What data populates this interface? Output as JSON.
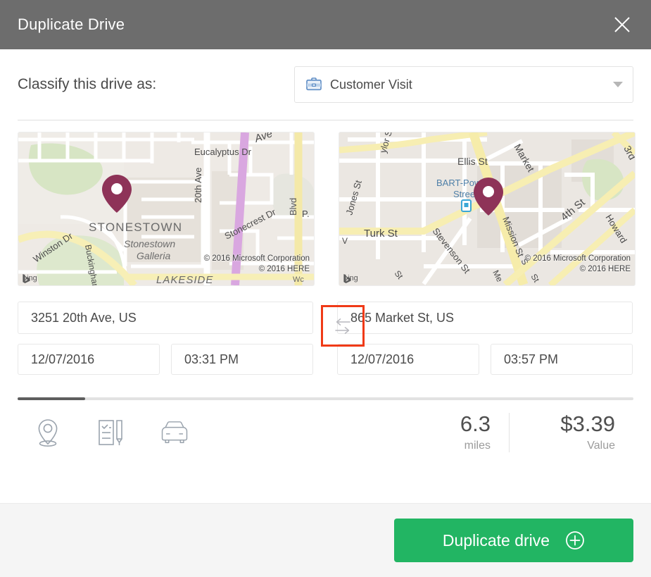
{
  "window": {
    "title": "Duplicate Drive",
    "close_icon": "close-icon"
  },
  "classify": {
    "label": "Classify this drive as:",
    "selected": "Customer Visit",
    "icon": "briefcase-icon",
    "caret_icon": "chevron-down-icon"
  },
  "maps": {
    "start": {
      "provider": "bing",
      "copyright_line1": "© 2016 Microsoft Corporation",
      "copyright_line2": "© 2016 HERE",
      "labels": [
        "Eucalyptus Dr",
        "20th Ave",
        "STONESTOWN",
        "Stonestown",
        "Galleria",
        "Winston Dr",
        "Buckingham",
        "Stonecrest Dr",
        "LAKESIDE",
        "Ave",
        "P",
        "Blvd"
      ]
    },
    "end": {
      "provider": "bing",
      "copyright_line1": "© 2016 Microsoft Corporation",
      "copyright_line2": "© 2016 HERE",
      "labels": [
        "Ellis St",
        "Market",
        "3rd",
        "Jones St",
        "ylor St",
        "BART-Powell",
        "Street",
        "Turk St",
        "Stevenson St",
        "Mission St",
        "4th St",
        "Howard",
        "St",
        "Me"
      ]
    }
  },
  "trip": {
    "start_address": "3251 20th Ave, US",
    "end_address": "865 Market St, US",
    "start_date": "12/07/2016",
    "start_time": "03:31 PM",
    "end_date": "12/07/2016",
    "end_time": "03:57 PM",
    "swap_icon": "swap-arrows-icon"
  },
  "progress": {
    "percent": 11
  },
  "stats": {
    "icons": [
      "location-pin-icon",
      "notes-icon",
      "car-icon"
    ],
    "values": [
      {
        "number": "6.3",
        "caption": "miles"
      },
      {
        "number": "$3.39",
        "caption": "Value"
      }
    ]
  },
  "footer": {
    "primary_label": "Duplicate drive",
    "primary_icon": "plus-circle-icon"
  },
  "colors": {
    "titlebar": "#6d6d6d",
    "accent_green": "#22b563",
    "highlight_red": "#f03a17",
    "text_dark": "#4a4a4a",
    "text_muted": "#9b9b9b",
    "footer_bg": "#f5f5f5",
    "map_pin": "#8e3358"
  }
}
